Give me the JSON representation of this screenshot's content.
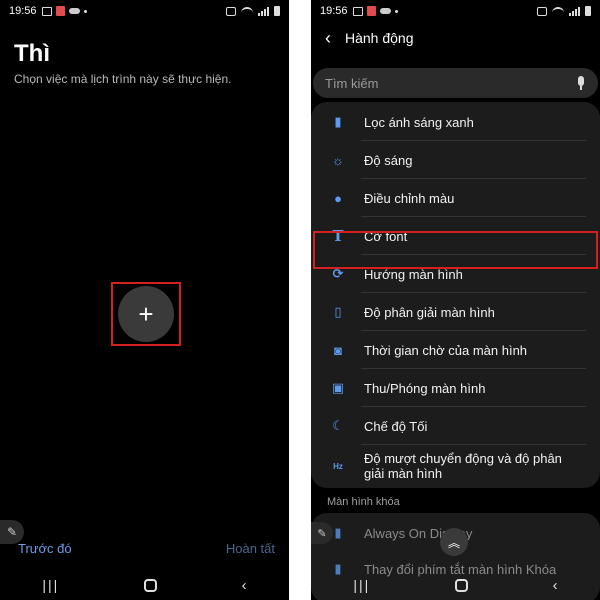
{
  "status_bar": {
    "time": "19:56"
  },
  "left_screen": {
    "title": "Thì",
    "subtitle": "Chọn việc mà lịch trình này sẽ thực hiện.",
    "add_label": "+",
    "prev_label": "Trước đó",
    "done_label": "Hoàn tất"
  },
  "right_screen": {
    "title": "Hành động",
    "search_placeholder": "Tìm kiếm",
    "items": [
      {
        "label": "Lọc ánh sáng xanh",
        "icon": "blue-light-filter-icon"
      },
      {
        "label": "Độ sáng",
        "icon": "brightness-icon"
      },
      {
        "label": "Điều chỉnh màu",
        "icon": "palette-icon"
      },
      {
        "label": "Cỡ font",
        "icon": "font-size-icon"
      },
      {
        "label": "Hướng màn hình",
        "icon": "screen-rotation-icon"
      },
      {
        "label": "Độ phân giải màn hình",
        "icon": "screen-resolution-icon"
      },
      {
        "label": "Thời gian chờ của màn hình",
        "icon": "screen-timeout-icon"
      },
      {
        "label": "Thu/Phóng màn hình",
        "icon": "screen-zoom-icon"
      },
      {
        "label": "Chế độ Tối",
        "icon": "dark-mode-icon"
      },
      {
        "label": "Độ mượt chuyển động và độ phân giải màn hình",
        "icon": "motion-smoothness-icon"
      }
    ],
    "section_header": "Màn hình khóa",
    "lock_items": [
      {
        "label": "Always On Display",
        "icon": "always-on-display-icon"
      },
      {
        "label": "Thay đổi phím tắt màn hình Khóa",
        "icon": "lock-screen-shortcut-icon"
      }
    ]
  },
  "colors": {
    "accent": "#5b9bf0",
    "highlight": "#d42020",
    "card": "#1c1c1c"
  }
}
